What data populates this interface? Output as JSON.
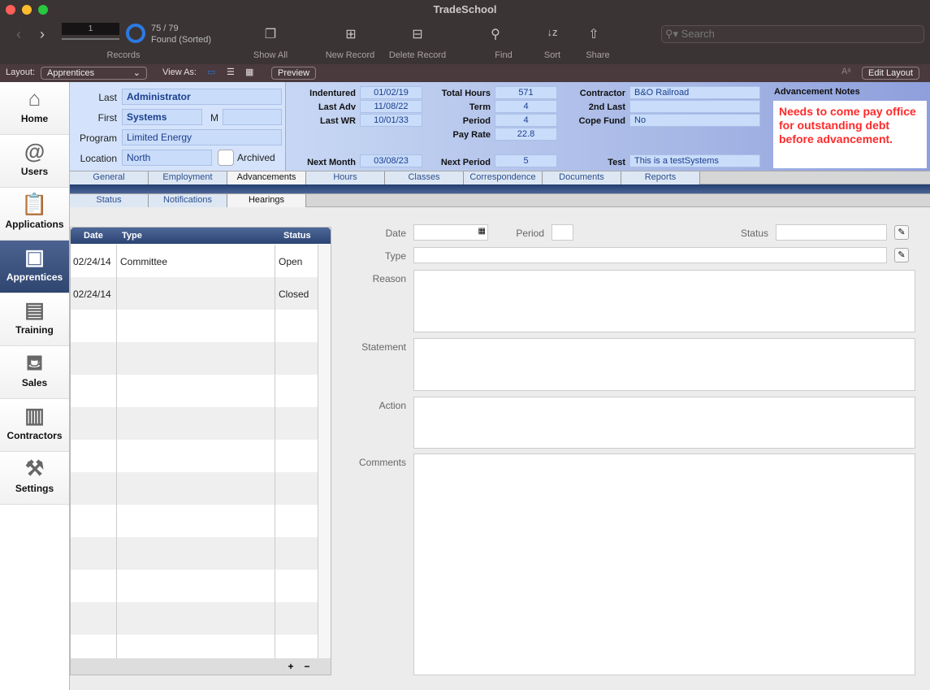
{
  "window": {
    "title": "TradeSchool"
  },
  "toolbar": {
    "record_number": "1",
    "found_count": "75 / 79",
    "found_status": "Found (Sorted)",
    "records_label": "Records",
    "show_all": "Show All",
    "new_record": "New Record",
    "delete_record": "Delete Record",
    "find": "Find",
    "sort": "Sort",
    "share": "Share",
    "search_placeholder": "Search"
  },
  "layoutbar": {
    "layout_label": "Layout:",
    "layout_value": "Apprentices",
    "view_as": "View As:",
    "preview": "Preview",
    "edit_layout": "Edit Layout"
  },
  "sidebar": {
    "items": [
      {
        "label": "Home",
        "icon": "house-icon"
      },
      {
        "label": "Users",
        "icon": "address-book-icon"
      },
      {
        "label": "Applications",
        "icon": "clipboard-icon"
      },
      {
        "label": "Apprentices",
        "icon": "id-card-icon"
      },
      {
        "label": "Training",
        "icon": "certificate-icon"
      },
      {
        "label": "Sales",
        "icon": "basket-icon"
      },
      {
        "label": "Contractors",
        "icon": "briefcase-icon"
      },
      {
        "label": "Settings",
        "icon": "tools-icon"
      }
    ]
  },
  "header": {
    "last_label": "Last",
    "last": "Administrator",
    "first_label": "First",
    "first": "Systems",
    "m_label": "M",
    "m": "",
    "program_label": "Program",
    "program": "Limited Energy",
    "location_label": "Location",
    "location": "North",
    "archived_label": "Archived",
    "indentured_label": "Indentured",
    "indentured": "01/02/19",
    "last_adv_label": "Last Adv",
    "last_adv": "11/08/22",
    "last_wr_label": "Last WR",
    "last_wr": "10/01/33",
    "next_month_label": "Next Month",
    "next_month": "03/08/23",
    "total_hours_label": "Total Hours",
    "total_hours": "571",
    "term_label": "Term",
    "term": "4",
    "period_label": "Period",
    "period": "4",
    "pay_rate_label": "Pay Rate",
    "pay_rate": "22.8",
    "next_period_label": "Next Period",
    "next_period": "5",
    "contractor_label": "Contractor",
    "contractor": "B&O Railroad",
    "second_last_label": "2nd Last",
    "second_last": "",
    "cope_fund_label": "Cope Fund",
    "cope_fund": "No",
    "test_label": "Test",
    "test": "This is a testSystems",
    "notes_label": "Advancement Notes",
    "notes": "Needs to come pay office for outstanding debt before advancement.",
    "notes_color": "#ff2a2a"
  },
  "tabs": [
    "General",
    "Employment",
    "Advancements",
    "Hours",
    "Classes",
    "Correspondence",
    "Documents",
    "Reports"
  ],
  "subtabs": [
    "Status",
    "Notifications",
    "Hearings"
  ],
  "portal": {
    "headers": [
      "Date",
      "Type",
      "Status"
    ],
    "rows": [
      {
        "date": "02/24/14",
        "type": "Committee",
        "status": "Open"
      },
      {
        "date": "02/24/14",
        "type": "",
        "status": "Closed"
      }
    ]
  },
  "form": {
    "date_label": "Date",
    "period_label": "Period",
    "status_label": "Status",
    "type_label": "Type",
    "reason_label": "Reason",
    "statement_label": "Statement",
    "action_label": "Action",
    "comments_label": "Comments"
  }
}
